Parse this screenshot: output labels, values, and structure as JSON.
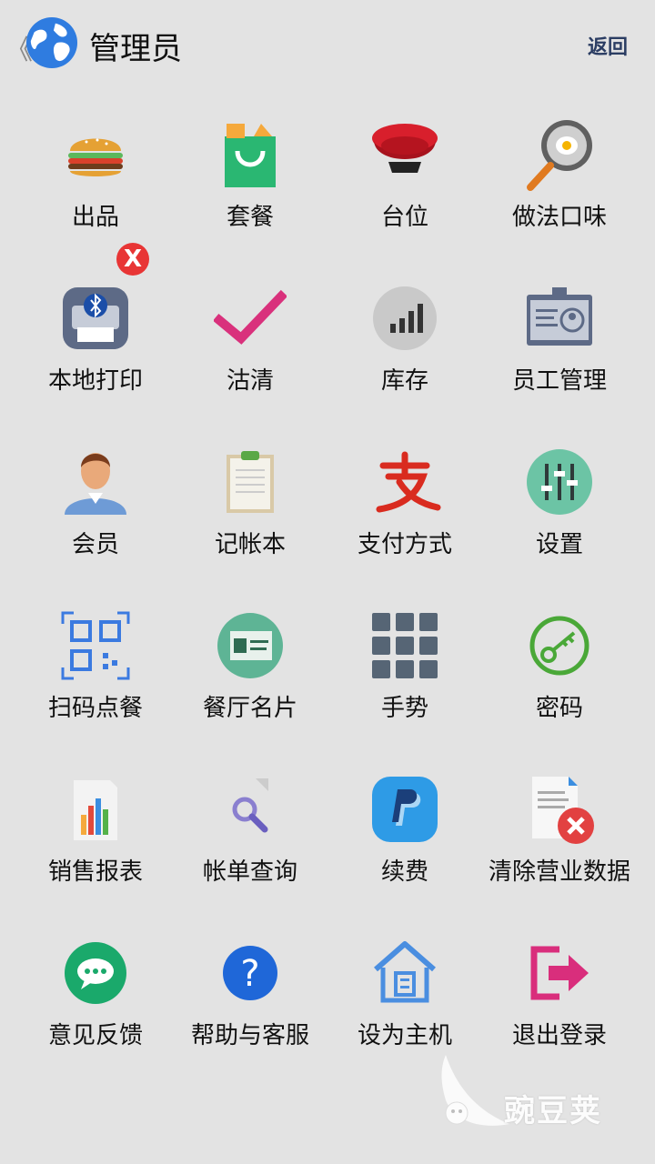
{
  "header": {
    "back_glyph": "《",
    "title": "管理员",
    "return_label": "返回"
  },
  "grid": [
    {
      "label": "出品",
      "icon": "burger-icon"
    },
    {
      "label": "套餐",
      "icon": "shopping-bag-icon"
    },
    {
      "label": "台位",
      "icon": "armchair-icon"
    },
    {
      "label": "做法口味",
      "icon": "frying-pan-icon"
    },
    {
      "label": "本地打印",
      "icon": "bluetooth-printer-icon"
    },
    {
      "label": "沽清",
      "icon": "checkmark-icon"
    },
    {
      "label": "库存",
      "icon": "bar-signal-icon"
    },
    {
      "label": "员工管理",
      "icon": "id-badge-icon"
    },
    {
      "label": "会员",
      "icon": "person-icon"
    },
    {
      "label": "记帐本",
      "icon": "clipboard-icon"
    },
    {
      "label": "支付方式",
      "icon": "alipay-icon"
    },
    {
      "label": "设置",
      "icon": "sliders-icon"
    },
    {
      "label": "扫码点餐",
      "icon": "qr-scan-icon"
    },
    {
      "label": "餐厅名片",
      "icon": "business-card-icon"
    },
    {
      "label": "手势",
      "icon": "grid-dots-icon"
    },
    {
      "label": "密码",
      "icon": "key-icon"
    },
    {
      "label": "销售报表",
      "icon": "report-chart-icon"
    },
    {
      "label": "帐单查询",
      "icon": "magnifier-icon"
    },
    {
      "label": "续费",
      "icon": "paypal-icon"
    },
    {
      "label": "清除营业数据",
      "icon": "delete-document-icon"
    },
    {
      "label": "意见反馈",
      "icon": "chat-bubble-icon"
    },
    {
      "label": "帮助与客服",
      "icon": "help-icon"
    },
    {
      "label": "设为主机",
      "icon": "house-icon"
    },
    {
      "label": "退出登录",
      "icon": "logout-icon"
    }
  ],
  "print_badge": "X",
  "watermark_text": "豌豆荚"
}
